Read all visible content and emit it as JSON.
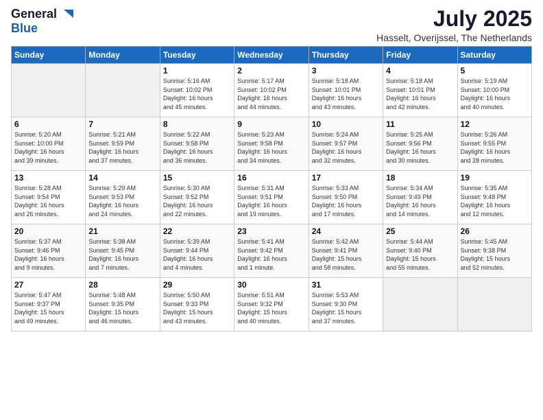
{
  "logo": {
    "general": "General",
    "blue": "Blue"
  },
  "title": "July 2025",
  "subtitle": "Hasselt, Overijssel, The Netherlands",
  "headers": [
    "Sunday",
    "Monday",
    "Tuesday",
    "Wednesday",
    "Thursday",
    "Friday",
    "Saturday"
  ],
  "weeks": [
    [
      {
        "day": "",
        "info": ""
      },
      {
        "day": "",
        "info": ""
      },
      {
        "day": "1",
        "info": "Sunrise: 5:16 AM\nSunset: 10:02 PM\nDaylight: 16 hours\nand 45 minutes."
      },
      {
        "day": "2",
        "info": "Sunrise: 5:17 AM\nSunset: 10:02 PM\nDaylight: 16 hours\nand 44 minutes."
      },
      {
        "day": "3",
        "info": "Sunrise: 5:18 AM\nSunset: 10:01 PM\nDaylight: 16 hours\nand 43 minutes."
      },
      {
        "day": "4",
        "info": "Sunrise: 5:18 AM\nSunset: 10:01 PM\nDaylight: 16 hours\nand 42 minutes."
      },
      {
        "day": "5",
        "info": "Sunrise: 5:19 AM\nSunset: 10:00 PM\nDaylight: 16 hours\nand 40 minutes."
      }
    ],
    [
      {
        "day": "6",
        "info": "Sunrise: 5:20 AM\nSunset: 10:00 PM\nDaylight: 16 hours\nand 39 minutes."
      },
      {
        "day": "7",
        "info": "Sunrise: 5:21 AM\nSunset: 9:59 PM\nDaylight: 16 hours\nand 37 minutes."
      },
      {
        "day": "8",
        "info": "Sunrise: 5:22 AM\nSunset: 9:58 PM\nDaylight: 16 hours\nand 36 minutes."
      },
      {
        "day": "9",
        "info": "Sunrise: 5:23 AM\nSunset: 9:58 PM\nDaylight: 16 hours\nand 34 minutes."
      },
      {
        "day": "10",
        "info": "Sunrise: 5:24 AM\nSunset: 9:57 PM\nDaylight: 16 hours\nand 32 minutes."
      },
      {
        "day": "11",
        "info": "Sunrise: 5:25 AM\nSunset: 9:56 PM\nDaylight: 16 hours\nand 30 minutes."
      },
      {
        "day": "12",
        "info": "Sunrise: 5:26 AM\nSunset: 9:55 PM\nDaylight: 16 hours\nand 28 minutes."
      }
    ],
    [
      {
        "day": "13",
        "info": "Sunrise: 5:28 AM\nSunset: 9:54 PM\nDaylight: 16 hours\nand 26 minutes."
      },
      {
        "day": "14",
        "info": "Sunrise: 5:29 AM\nSunset: 9:53 PM\nDaylight: 16 hours\nand 24 minutes."
      },
      {
        "day": "15",
        "info": "Sunrise: 5:30 AM\nSunset: 9:52 PM\nDaylight: 16 hours\nand 22 minutes."
      },
      {
        "day": "16",
        "info": "Sunrise: 5:31 AM\nSunset: 9:51 PM\nDaylight: 16 hours\nand 19 minutes."
      },
      {
        "day": "17",
        "info": "Sunrise: 5:33 AM\nSunset: 9:50 PM\nDaylight: 16 hours\nand 17 minutes."
      },
      {
        "day": "18",
        "info": "Sunrise: 5:34 AM\nSunset: 9:49 PM\nDaylight: 16 hours\nand 14 minutes."
      },
      {
        "day": "19",
        "info": "Sunrise: 5:35 AM\nSunset: 9:48 PM\nDaylight: 16 hours\nand 12 minutes."
      }
    ],
    [
      {
        "day": "20",
        "info": "Sunrise: 5:37 AM\nSunset: 9:46 PM\nDaylight: 16 hours\nand 9 minutes."
      },
      {
        "day": "21",
        "info": "Sunrise: 5:38 AM\nSunset: 9:45 PM\nDaylight: 16 hours\nand 7 minutes."
      },
      {
        "day": "22",
        "info": "Sunrise: 5:39 AM\nSunset: 9:44 PM\nDaylight: 16 hours\nand 4 minutes."
      },
      {
        "day": "23",
        "info": "Sunrise: 5:41 AM\nSunset: 9:42 PM\nDaylight: 16 hours\nand 1 minute."
      },
      {
        "day": "24",
        "info": "Sunrise: 5:42 AM\nSunset: 9:41 PM\nDaylight: 15 hours\nand 58 minutes."
      },
      {
        "day": "25",
        "info": "Sunrise: 5:44 AM\nSunset: 9:40 PM\nDaylight: 15 hours\nand 55 minutes."
      },
      {
        "day": "26",
        "info": "Sunrise: 5:45 AM\nSunset: 9:38 PM\nDaylight: 15 hours\nand 52 minutes."
      }
    ],
    [
      {
        "day": "27",
        "info": "Sunrise: 5:47 AM\nSunset: 9:37 PM\nDaylight: 15 hours\nand 49 minutes."
      },
      {
        "day": "28",
        "info": "Sunrise: 5:48 AM\nSunset: 9:35 PM\nDaylight: 15 hours\nand 46 minutes."
      },
      {
        "day": "29",
        "info": "Sunrise: 5:50 AM\nSunset: 9:33 PM\nDaylight: 15 hours\nand 43 minutes."
      },
      {
        "day": "30",
        "info": "Sunrise: 5:51 AM\nSunset: 9:32 PM\nDaylight: 15 hours\nand 40 minutes."
      },
      {
        "day": "31",
        "info": "Sunrise: 5:53 AM\nSunset: 9:30 PM\nDaylight: 15 hours\nand 37 minutes."
      },
      {
        "day": "",
        "info": ""
      },
      {
        "day": "",
        "info": ""
      }
    ]
  ]
}
